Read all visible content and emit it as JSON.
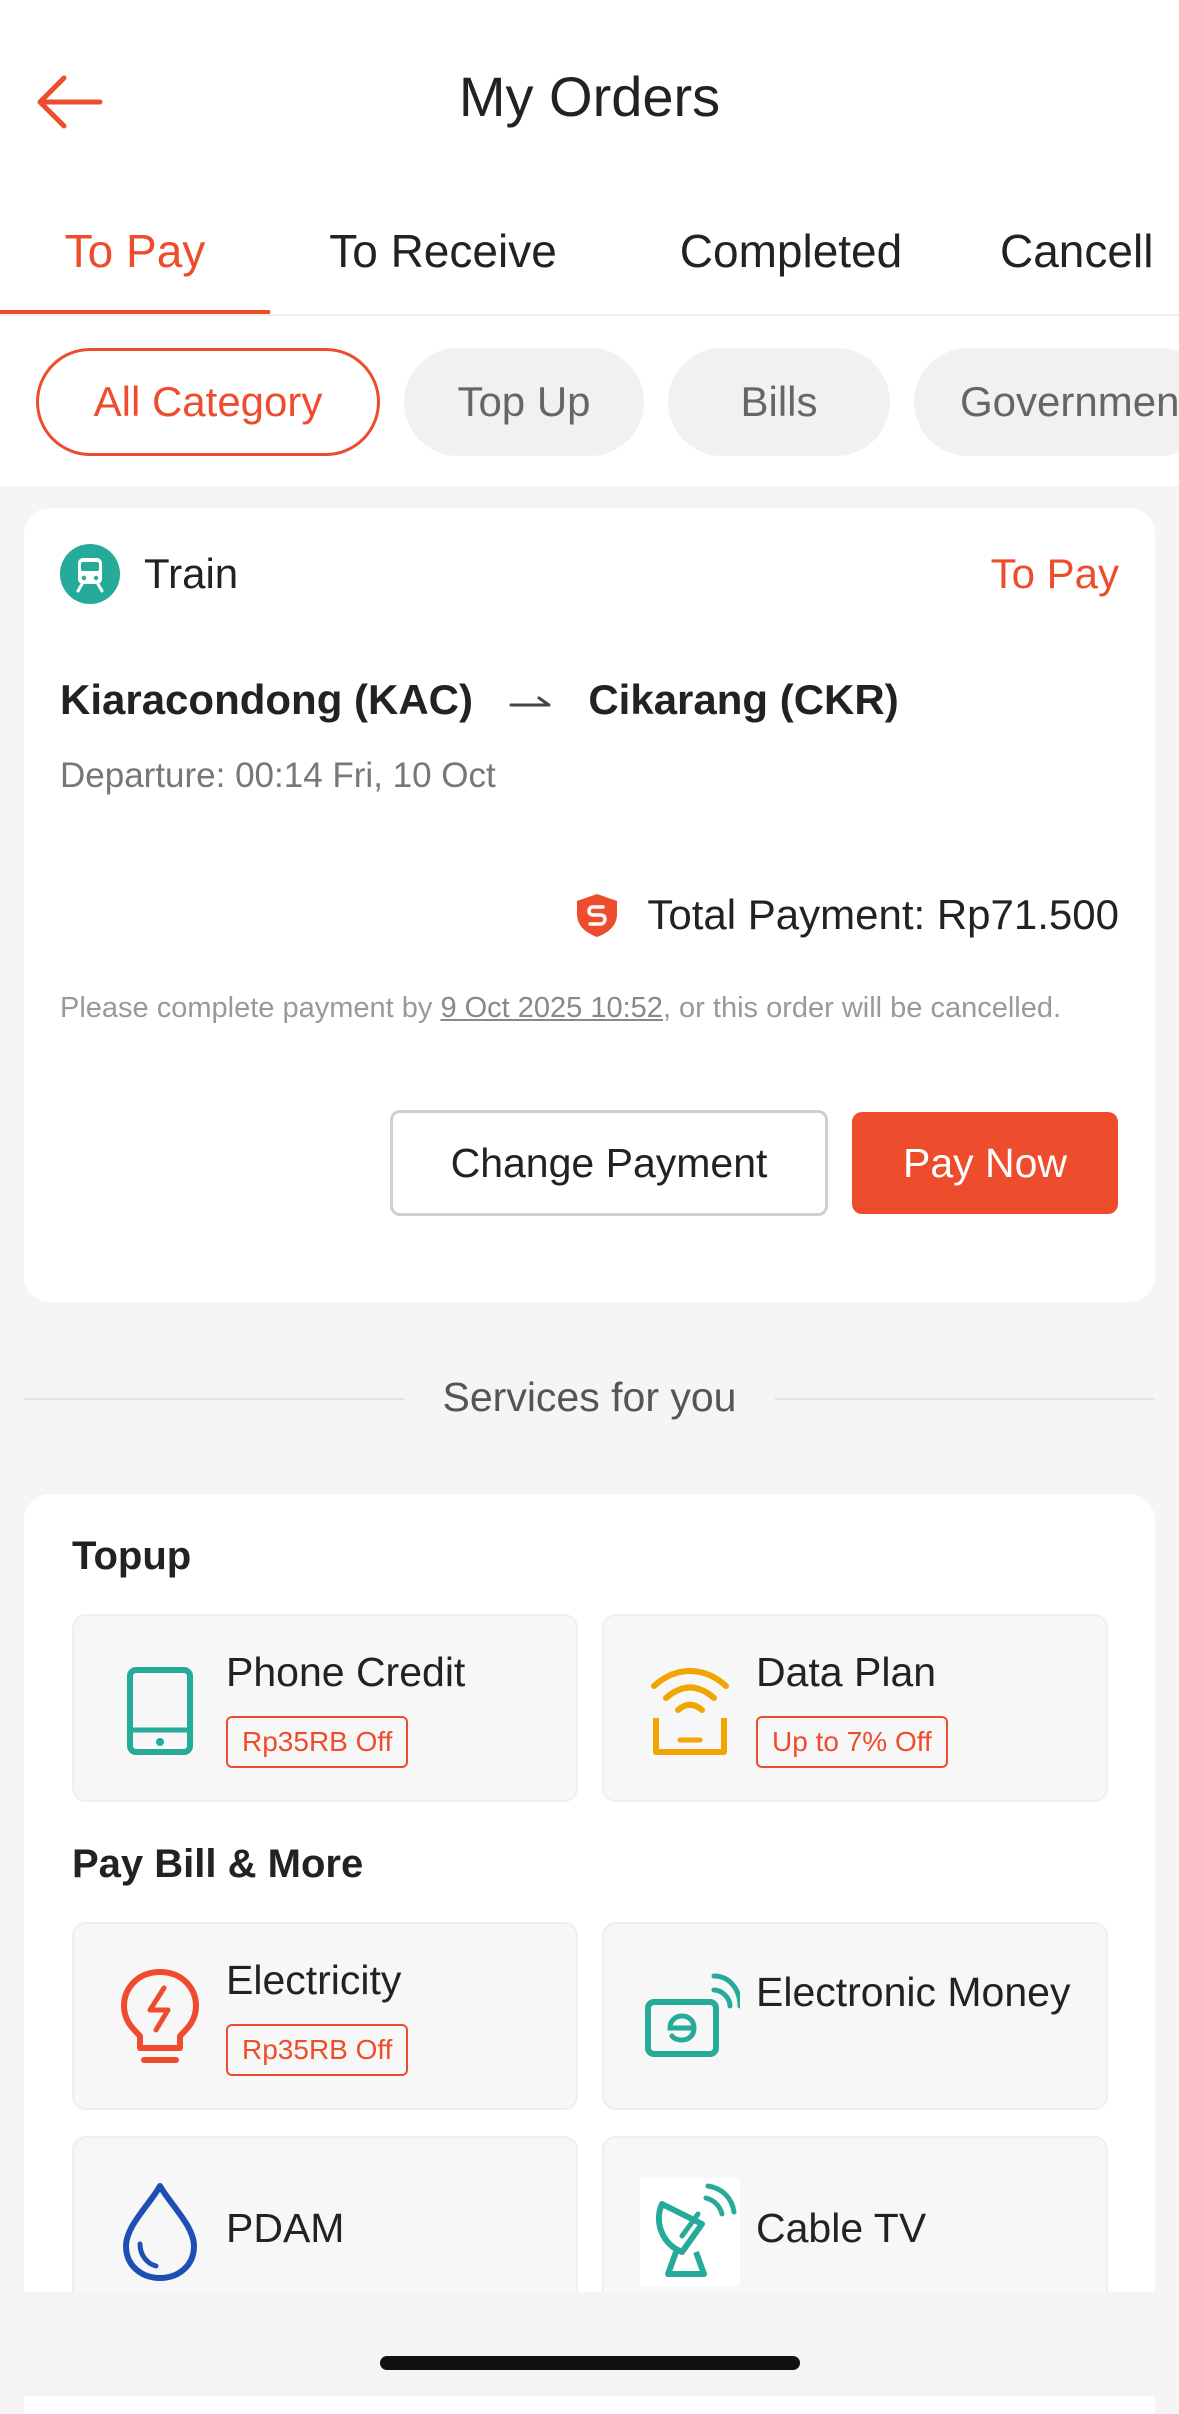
{
  "header": {
    "title": "My Orders"
  },
  "tabs": [
    {
      "label": "To Pay",
      "active": true
    },
    {
      "label": "To Receive",
      "active": false
    },
    {
      "label": "Completed",
      "active": false
    },
    {
      "label": "Cancell",
      "active": false
    }
  ],
  "chips": [
    {
      "label": "All Category",
      "active": true
    },
    {
      "label": "Top Up",
      "active": false
    },
    {
      "label": "Bills",
      "active": false
    },
    {
      "label": "Governmen",
      "active": false
    }
  ],
  "order": {
    "category": "Train",
    "category_icon": "train-icon",
    "status": "To Pay",
    "origin": "Kiaracondong (KAC)",
    "destination": "Cikarang (CKR)",
    "departure": "Departure: 00:14 Fri, 10 Oct",
    "total_label": "Total Payment:",
    "total_value": "Rp71.500",
    "note_prefix": "Please complete payment by ",
    "note_deadline": "9 Oct 2025 10:52",
    "note_suffix": ", or this order will be cancelled.",
    "change_payment_label": "Change Payment",
    "pay_now_label": "Pay Now"
  },
  "services": {
    "divider_label": "Services for you",
    "sections": [
      {
        "title": "Topup",
        "items": [
          {
            "name": "Phone Credit",
            "promo": "Rp35RB Off",
            "icon": "phone-credit-icon"
          },
          {
            "name": "Data Plan",
            "promo": "Up to 7% Off",
            "icon": "data-plan-icon"
          }
        ]
      },
      {
        "title": "Pay Bill & More",
        "items": [
          {
            "name": "Electricity",
            "promo": "Rp35RB Off",
            "icon": "electricity-icon"
          },
          {
            "name": "Electronic Money",
            "promo": "",
            "icon": "electronic-money-icon"
          },
          {
            "name": "PDAM",
            "promo": "",
            "icon": "water-drop-icon"
          },
          {
            "name": "Cable TV",
            "promo": "",
            "icon": "satellite-dish-icon"
          }
        ]
      }
    ]
  },
  "colors": {
    "accent": "#ee4d2d",
    "teal": "#26aa99",
    "amber": "#f0a500",
    "blue": "#1e4fb4"
  }
}
